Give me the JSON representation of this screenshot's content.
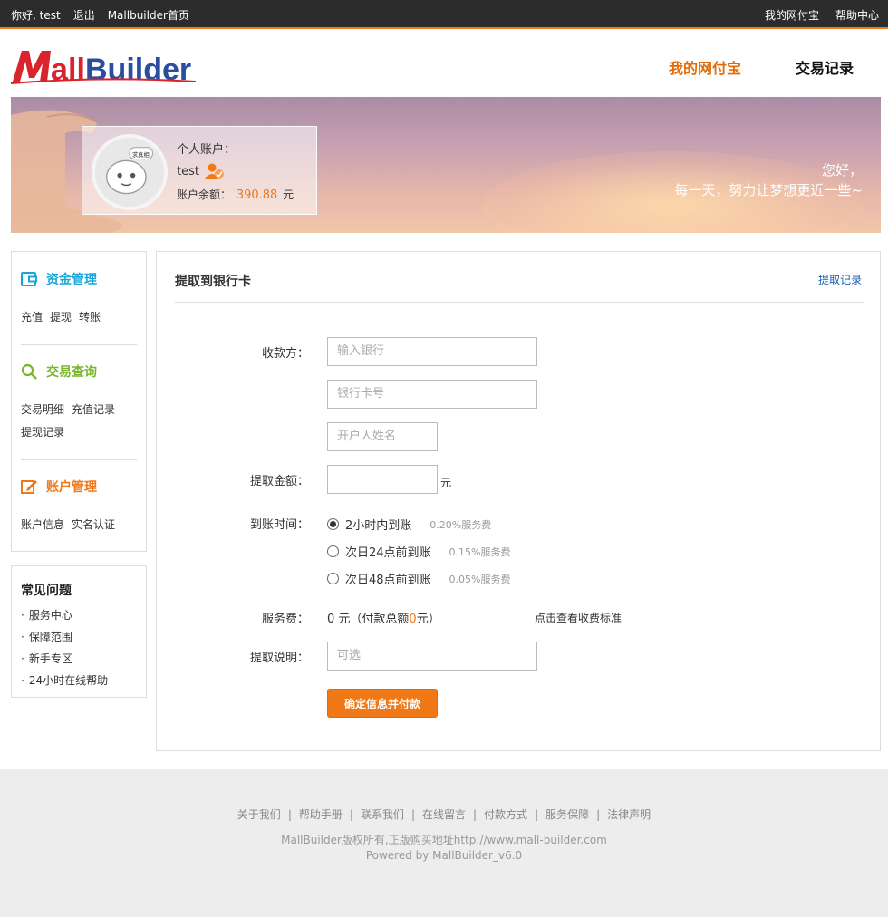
{
  "topbar": {
    "greeting": "你好, test",
    "logout": "退出",
    "home": "Mallbuilder首页",
    "my_wallet": "我的网付宝",
    "help": "帮助中心"
  },
  "header": {
    "logo_text": "MallBuilder",
    "nav": [
      "我的网付宝",
      "交易记录"
    ]
  },
  "banner": {
    "account_label": "个人账户：",
    "username": "test",
    "balance_label": "账户余额：",
    "balance": "390.88",
    "balance_unit": "元",
    "avatar_text": "求真相",
    "greeting_line1": "您好，",
    "greeting_line2": "每一天，努力让梦想更近一些~"
  },
  "sidebar": {
    "funds": {
      "title": "资金管理",
      "links": [
        "充值",
        "提现",
        "转账"
      ]
    },
    "query": {
      "title": "交易查询",
      "links": [
        "交易明细",
        "充值记录",
        "提现记录"
      ]
    },
    "account": {
      "title": "账户管理",
      "links": [
        "账户信息",
        "实名认证"
      ]
    }
  },
  "faq": {
    "title": "常见问题",
    "items": [
      "服务中心",
      "保障范围",
      "新手专区",
      "24小时在线帮助"
    ]
  },
  "form": {
    "title": "提取到银行卡",
    "history_link": "提取记录",
    "payee_label": "收款方：",
    "bank_placeholder": "输入银行",
    "card_placeholder": "银行卡号",
    "holder_placeholder": "开户人姓名",
    "amount_label": "提取金额：",
    "amount_unit": "元",
    "time_label": "到账时间：",
    "options": [
      {
        "label": "2小时内到账",
        "fee": "0.20%服务费",
        "selected": true
      },
      {
        "label": "次日24点前到账",
        "fee": "0.15%服务费",
        "selected": false
      },
      {
        "label": "次日48点前到账",
        "fee": "0.05%服务费",
        "selected": false
      }
    ],
    "fee_label": "服务费：",
    "fee_value": "0 元（付款总额",
    "fee_total": "0",
    "fee_suffix": "元）",
    "fee_standard": "点击查看收费标准",
    "note_label": "提取说明：",
    "note_placeholder": "可选",
    "submit": "确定信息并付款"
  },
  "footer": {
    "links": [
      "关于我们",
      "帮助手册",
      "联系我们",
      "在线留言",
      "付款方式",
      "服务保障",
      "法律声明"
    ],
    "separator": "|",
    "copyright": "MallBuilder版权所有,正版购买地址http://www.mall-builder.com",
    "powered": "Powered by MallBuilder_v6.0"
  },
  "colors": {
    "accent": "#f07817",
    "funds": "#1aa7d8",
    "query": "#7ab62b",
    "account": "#f07817",
    "link": "#1a5fb4"
  }
}
